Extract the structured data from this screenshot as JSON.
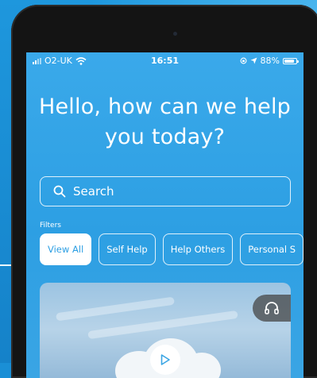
{
  "status_bar": {
    "carrier": "O2-UK",
    "time": "16:51",
    "battery_percent": "88%",
    "battery_level": 0.88
  },
  "headline": "Hello, how can we help you today?",
  "search": {
    "placeholder": "Search"
  },
  "filters": {
    "label": "Filters",
    "chips": [
      "View All",
      "Self Help",
      "Help Others",
      "Personal S"
    ],
    "active_index": 0
  },
  "card": {
    "audio_icon": "headphones-icon",
    "play_icon": "play-icon"
  },
  "colors": {
    "screen_blue": "#2d9fe3",
    "background_blue": "#1a8fd6",
    "chip_active_bg": "#ffffff"
  }
}
